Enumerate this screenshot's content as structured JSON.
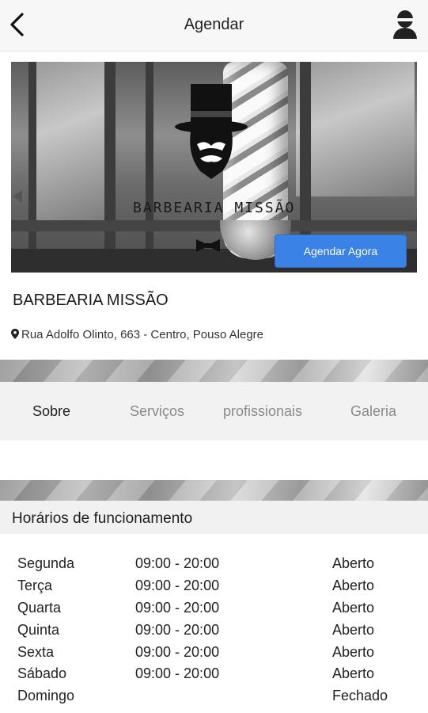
{
  "header": {
    "title": "Agendar",
    "back_icon": "chevron-left-icon",
    "profile_icon": "user-avatar-icon"
  },
  "hero": {
    "brand_text": "BARBEARIA MISSÃO",
    "cta_label": "Agendar Agora",
    "accent_color": "#3a82e6"
  },
  "business": {
    "name": "BARBEARIA MISSÃO",
    "address": "Rua Adolfo Olinto, 663 - Centro, Pouso Alegre"
  },
  "tabs": [
    {
      "label": "Sobre",
      "active": true
    },
    {
      "label": "Serviços",
      "active": false
    },
    {
      "label": "profissionais",
      "active": false
    },
    {
      "label": "Galeria",
      "active": false
    }
  ],
  "hours": {
    "title": "Horários de funcionamento",
    "rows": [
      {
        "day": "Segunda",
        "time": "09:00 - 20:00",
        "status": "Aberto"
      },
      {
        "day": "Terça",
        "time": "09:00 - 20:00",
        "status": "Aberto"
      },
      {
        "day": "Quarta",
        "time": "09:00 - 20:00",
        "status": "Aberto"
      },
      {
        "day": "Quinta",
        "time": "09:00 - 20:00",
        "status": "Aberto"
      },
      {
        "day": "Sexta",
        "time": "09:00 - 20:00",
        "status": "Aberto"
      },
      {
        "day": "Sábado",
        "time": "09:00 - 20:00",
        "status": "Aberto"
      },
      {
        "day": "Domingo",
        "time": "",
        "status": "Fechado"
      }
    ]
  }
}
